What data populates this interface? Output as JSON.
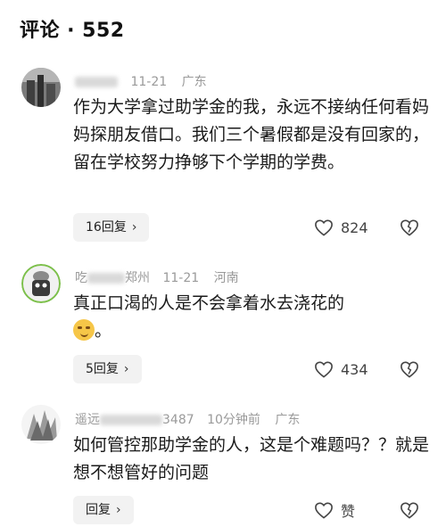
{
  "header": {
    "title": "评论 · 552"
  },
  "comments": [
    {
      "name_visible": "",
      "date": "11-21",
      "region": "广东",
      "text": "作为大学拿过助学金的我，永远不接纳任何看妈妈探朋友借口。我们三个暑假都是没有回家的，留在学校努力挣够下个学期的学费。",
      "reply_label": "16回复",
      "likes": "824"
    },
    {
      "name_visible_start": "吃",
      "name_visible_end": "郑州",
      "date": "11-21",
      "region": "河南",
      "text": "真正口渴的人是不会拿着水去浇花的",
      "text_end": "。",
      "reply_label": "5回复",
      "likes": "434"
    },
    {
      "name_visible_start": "遥远",
      "name_visible_end": "3487",
      "date": "10分钟前",
      "region": "广东",
      "text": "如何管控那助学金的人，这是个难题吗？？就是想不想管好的问题",
      "reply_label": "回复",
      "likes": "赞"
    }
  ]
}
